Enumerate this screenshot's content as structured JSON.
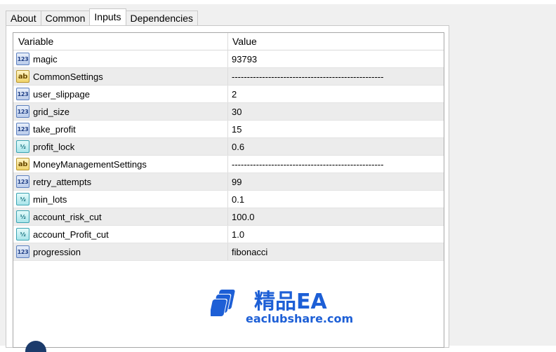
{
  "tabs": [
    {
      "label": "About",
      "active": false
    },
    {
      "label": "Common",
      "active": false
    },
    {
      "label": "Inputs",
      "active": true
    },
    {
      "label": "Dependencies",
      "active": false
    }
  ],
  "grid": {
    "headers": {
      "variable": "Variable",
      "value": "Value"
    },
    "rows": [
      {
        "icon": "int-type-icon",
        "icon_text": "123",
        "name": "magic",
        "value": "93793"
      },
      {
        "icon": "string-type-icon",
        "icon_text": "ab",
        "name": "CommonSettings",
        "value": "--------------------------------------------------"
      },
      {
        "icon": "int-type-icon",
        "icon_text": "123",
        "name": "user_slippage",
        "value": "2"
      },
      {
        "icon": "int-type-icon",
        "icon_text": "123",
        "name": "grid_size",
        "value": "30"
      },
      {
        "icon": "int-type-icon",
        "icon_text": "123",
        "name": "take_profit",
        "value": "15"
      },
      {
        "icon": "double-type-icon",
        "icon_text": "½",
        "name": "profit_lock",
        "value": "0.6"
      },
      {
        "icon": "string-type-icon",
        "icon_text": "ab",
        "name": "MoneyManagementSettings",
        "value": "--------------------------------------------------"
      },
      {
        "icon": "int-type-icon",
        "icon_text": "123",
        "name": "retry_attempts",
        "value": "99"
      },
      {
        "icon": "double-type-icon",
        "icon_text": "½",
        "name": "min_lots",
        "value": "0.1"
      },
      {
        "icon": "double-type-icon",
        "icon_text": "½",
        "name": "account_risk_cut",
        "value": "100.0"
      },
      {
        "icon": "double-type-icon",
        "icon_text": "½",
        "name": "account_Profit_cut",
        "value": "1.0"
      },
      {
        "icon": "int-type-icon",
        "icon_text": "123",
        "name": "progression",
        "value": "fibonacci"
      }
    ]
  },
  "watermark": {
    "title": "精品EA",
    "url": "eaclubshare.com",
    "color": "#1d5fd6"
  }
}
